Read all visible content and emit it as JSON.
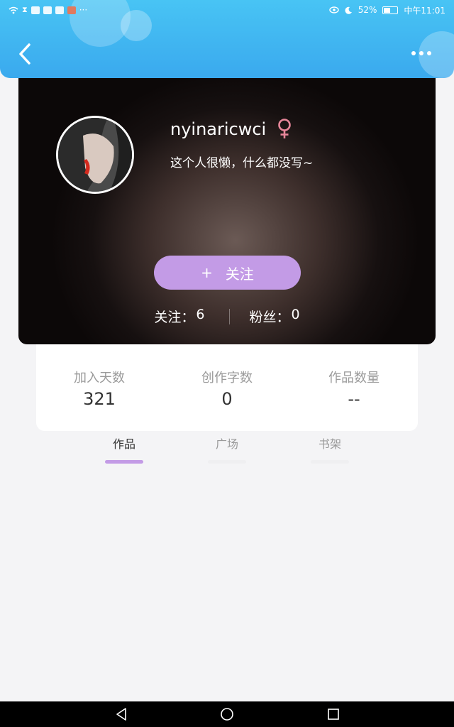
{
  "status_bar": {
    "battery": "52%",
    "time": "中午11:01",
    "more": "···"
  },
  "header": {
    "back_icon": "chevron-left-icon",
    "more_icon": "more-dots-icon"
  },
  "profile": {
    "username": "nyinaricwci",
    "gender_icon": "female-icon",
    "gender_color": "#e8879a",
    "bio": "这个人很懒，什么都没写~",
    "follow_button": {
      "plus": "+",
      "label": "关注",
      "color": "#c39be6"
    },
    "following": {
      "label": "关注：",
      "value": "6"
    },
    "followers": {
      "label": "粉丝：",
      "value": "0"
    }
  },
  "info": [
    {
      "label": "加入天数",
      "value": "321"
    },
    {
      "label": "创作字数",
      "value": "0"
    },
    {
      "label": "作品数量",
      "value": "--"
    }
  ],
  "tabs": [
    {
      "label": "作品",
      "active": true
    },
    {
      "label": "广场",
      "active": false
    },
    {
      "label": "书架",
      "active": false
    }
  ],
  "colors": {
    "header_blue": "#3aa9ee",
    "accent_purple": "#c39be6"
  }
}
